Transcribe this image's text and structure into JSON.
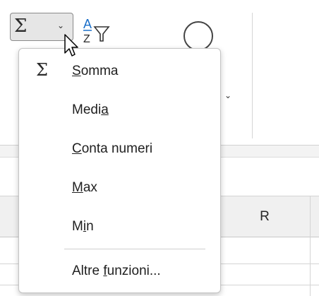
{
  "ribbon": {
    "autosum_glyph": "Σ",
    "autosum_caret": "⌄",
    "sort_filter_letter": "A",
    "sort_filter_letter2": "Z",
    "find_caret": "⌄"
  },
  "grid": {
    "column_header": "R"
  },
  "menu": {
    "items": [
      {
        "icon": "Σ",
        "pre": "",
        "acc": "S",
        "post": "omma"
      },
      {
        "pre": "Medi",
        "acc": "a",
        "post": ""
      },
      {
        "pre": "",
        "acc": "C",
        "post": "onta numeri"
      },
      {
        "pre": "",
        "acc": "M",
        "post": "ax"
      },
      {
        "pre": "M",
        "acc": "i",
        "post": "n"
      },
      {
        "pre": "Altre ",
        "acc": "f",
        "post": "unzioni..."
      }
    ]
  },
  "colors": {
    "button_bg": "#e6e6e6",
    "menu_bg": "#ffffff",
    "header_bg": "#f0f0f0"
  }
}
